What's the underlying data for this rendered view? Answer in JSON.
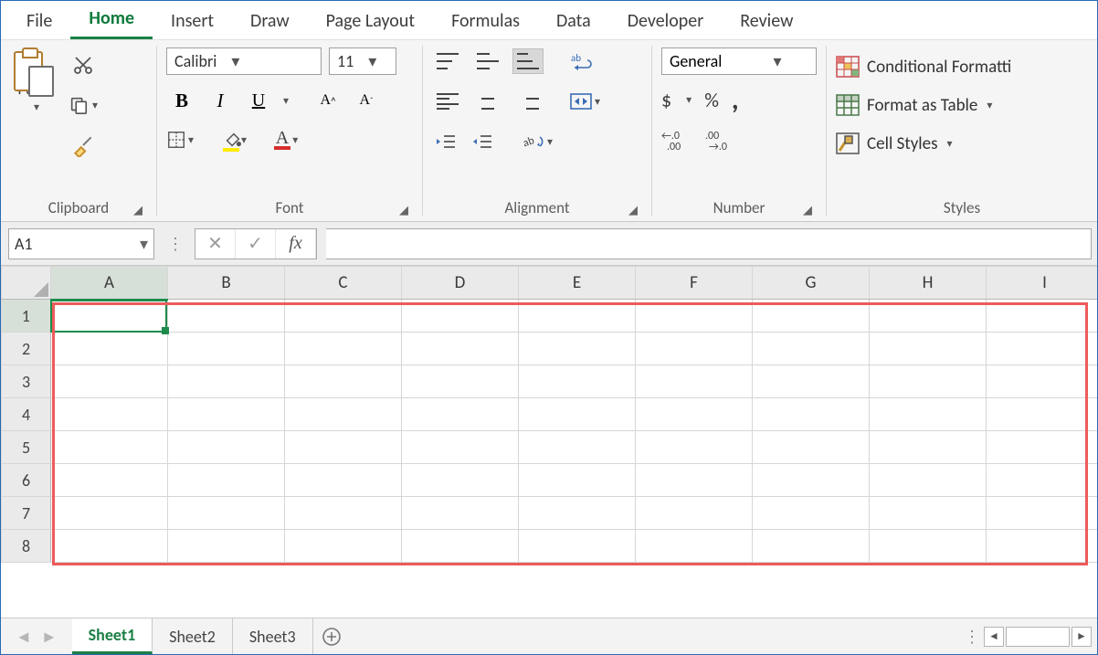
{
  "tabs": {
    "file": "File",
    "home": "Home",
    "insert": "Insert",
    "draw": "Draw",
    "page_layout": "Page Layout",
    "formulas": "Formulas",
    "data": "Data",
    "developer": "Developer",
    "review": "Review",
    "active": "home"
  },
  "ribbon": {
    "clipboard": {
      "label": "Clipboard",
      "paste": "Paste"
    },
    "font": {
      "label": "Font",
      "name": "Calibri",
      "size": "11",
      "B": "B",
      "I": "I",
      "U": "U"
    },
    "alignment": {
      "label": "Alignment"
    },
    "number": {
      "label": "Number",
      "format": "General",
      "currency": "$",
      "percent": "%",
      "comma": ","
    },
    "styles": {
      "label": "Styles",
      "cond": "Conditional Formatti",
      "table": "Format as Table",
      "cells": "Cell Styles"
    }
  },
  "fxbar": {
    "name_box": "A1",
    "cancel": "✕",
    "enter": "✓",
    "fx": "fx",
    "formula": ""
  },
  "grid": {
    "columns": [
      "A",
      "B",
      "C",
      "D",
      "E",
      "F",
      "G",
      "H",
      "I"
    ],
    "rows": [
      "1",
      "2",
      "3",
      "4",
      "5",
      "6",
      "7",
      "8"
    ],
    "active_cell": "A1"
  },
  "sheets": {
    "items": [
      "Sheet1",
      "Sheet2",
      "Sheet3"
    ],
    "active": 0
  }
}
